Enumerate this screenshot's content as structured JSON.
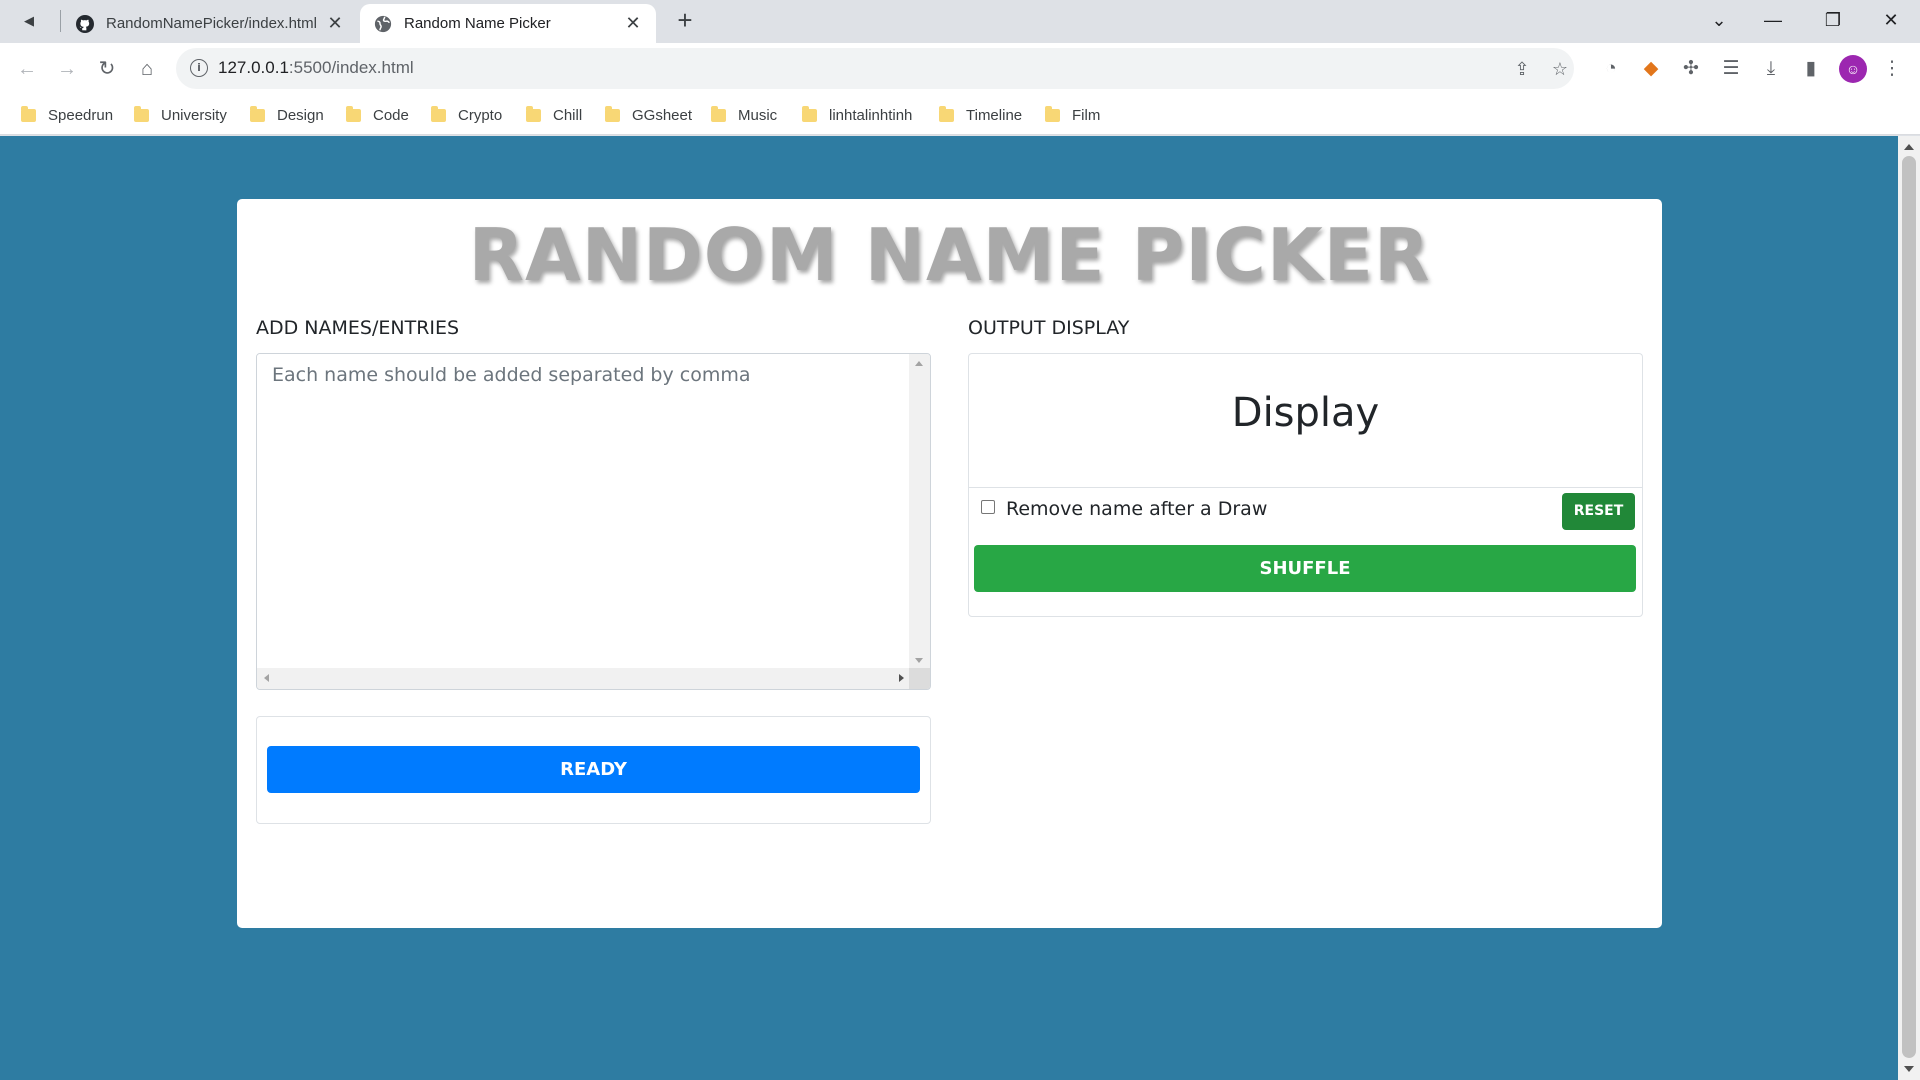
{
  "browser": {
    "tabs": [
      {
        "title": "RandomNamePicker/index.html",
        "active": false
      },
      {
        "title": "Random Name Picker",
        "active": true
      }
    ],
    "url_host": "127.0.0.1",
    "url_path": ":5500/index.html",
    "bookmarks": [
      "Speedrun",
      "University",
      "Design",
      "Code",
      "Crypto",
      "Chill",
      "GGsheet",
      "Music",
      "linhtalinhtinh",
      "Timeline",
      "Film"
    ]
  },
  "page": {
    "title": "RANDOM NAME PICKER",
    "entries_label": "ADD NAMES/ENTRIES",
    "entries_placeholder": "Each name should be added separated by comma",
    "entries_value": "",
    "ready_label": "READY",
    "output_label": "OUTPUT DISPLAY",
    "display_text": "Display",
    "remove_label": "Remove name after a Draw",
    "remove_checked": false,
    "reset_label": "RESET",
    "shuffle_label": "SHUFFLE"
  },
  "colors": {
    "page_background": "#2e7ca2",
    "ready_button": "#007bff",
    "shuffle_button": "#28a745",
    "reset_button": "#218838",
    "title_text": "#a9a9a9"
  }
}
